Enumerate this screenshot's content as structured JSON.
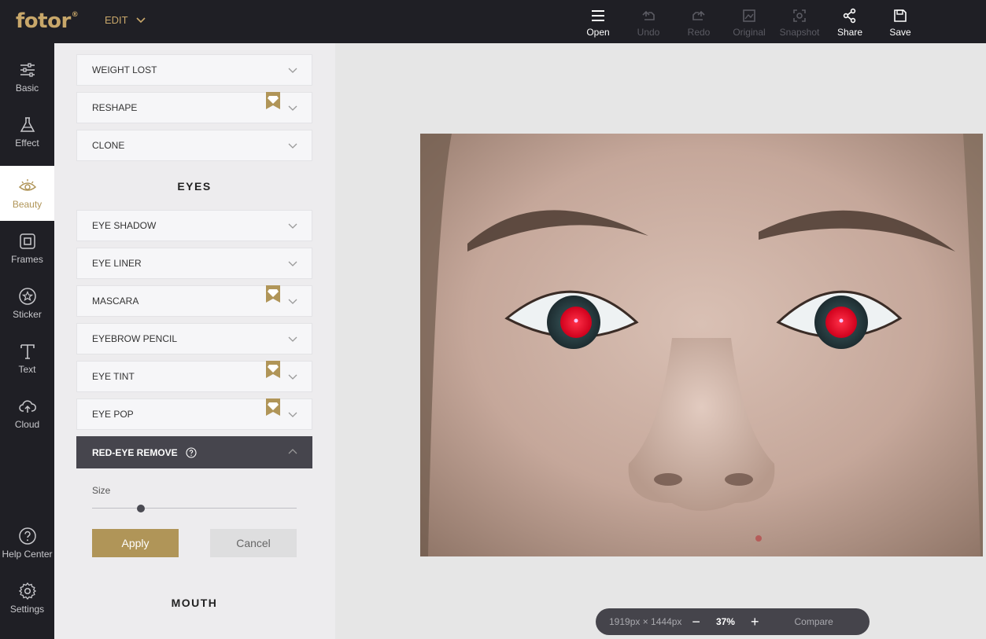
{
  "app": {
    "logo": "fotor",
    "logo_mark": "®",
    "menu_label": "EDIT"
  },
  "toolbar": {
    "items": [
      {
        "label": "Open",
        "icon": "menu-icon",
        "enabled": true
      },
      {
        "label": "Undo",
        "icon": "undo-icon",
        "enabled": false
      },
      {
        "label": "Redo",
        "icon": "redo-icon",
        "enabled": false
      },
      {
        "label": "Original",
        "icon": "image-icon",
        "enabled": false
      },
      {
        "label": "Snapshot",
        "icon": "snapshot-icon",
        "enabled": false
      },
      {
        "label": "Share",
        "icon": "share-icon",
        "enabled": true
      },
      {
        "label": "Save",
        "icon": "save-icon",
        "enabled": true
      }
    ]
  },
  "rail": {
    "items": [
      {
        "label": "Basic",
        "icon": "sliders-icon"
      },
      {
        "label": "Effect",
        "icon": "flask-icon"
      },
      {
        "label": "Beauty",
        "icon": "eye-icon",
        "active": true
      },
      {
        "label": "Frames",
        "icon": "frame-icon"
      },
      {
        "label": "Sticker",
        "icon": "star-icon"
      },
      {
        "label": "Text",
        "icon": "text-icon"
      },
      {
        "label": "Cloud",
        "icon": "cloud-upload-icon"
      }
    ],
    "help_label": "Help Center",
    "settings_label": "Settings"
  },
  "panel": {
    "top_items": [
      {
        "label": "WEIGHT LOST",
        "premium": false
      },
      {
        "label": "RESHAPE",
        "premium": true
      },
      {
        "label": "CLONE",
        "premium": false
      }
    ],
    "eyes_title": "EYES",
    "eyes_items": [
      {
        "label": "EYE SHADOW",
        "premium": false
      },
      {
        "label": "EYE LINER",
        "premium": false
      },
      {
        "label": "MASCARA",
        "premium": true
      },
      {
        "label": "EYEBROW PENCIL",
        "premium": false
      },
      {
        "label": "EYE TINT",
        "premium": true
      },
      {
        "label": "EYE POP",
        "premium": true
      }
    ],
    "open_item": {
      "label": "RED-EYE REMOVE",
      "size_label": "Size",
      "size_value": 0.24,
      "apply_label": "Apply",
      "cancel_label": "Cancel"
    },
    "mouth_title": "MOUTH"
  },
  "zoom": {
    "dimensions": "1919px × 1444px",
    "minus": "−",
    "percent": "37%",
    "plus": "+",
    "compare_label": "Compare"
  },
  "colors": {
    "accent": "#b09558",
    "logo": "#c8a76a",
    "dark": "#1f1f25",
    "open_bar": "#46454d"
  }
}
